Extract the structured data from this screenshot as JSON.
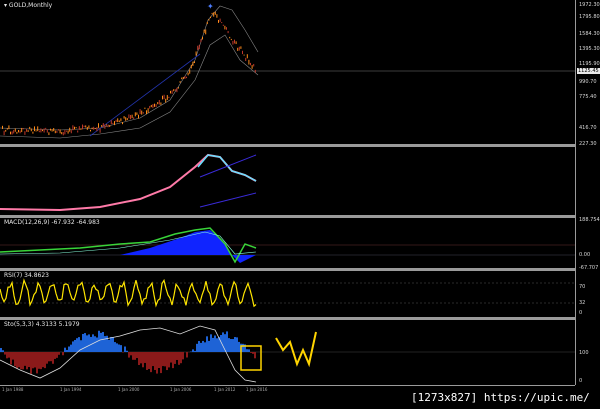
{
  "panes": {
    "main": {
      "label": "GOLD,Monthly",
      "ticks": [
        "1972.30",
        "1795.80",
        "1584.30",
        "1395.30",
        "1195.90",
        "990.70",
        "775.40",
        "416.70",
        "227.30"
      ],
      "price_tag": "1125.45"
    },
    "ma": {
      "label": ""
    },
    "macd": {
      "label": "MACD(12,26,9) -67.932 -64.983",
      "ticks": [
        "188.754",
        "0.00",
        "-67.707"
      ]
    },
    "rsi": {
      "label": "RSI(7) 34.8623",
      "ticks": [
        "70",
        "32",
        "0"
      ]
    },
    "stoch": {
      "label": "Sto(5,3,3) 4.3133 5.1979",
      "ticks": [
        "100",
        "0"
      ]
    }
  },
  "xaxis": {
    "ticks": [
      "1 Jan 1988",
      "1 Jan 1994",
      "1 Jan 2000",
      "1 Jan 2006",
      "1 Jan 2012",
      "1 Jan 2016"
    ]
  },
  "watermark": "[1273x827] https://upic.me/",
  "colors": {
    "bull": "#ff8c1a",
    "bear": "#c0392b",
    "macd_line": "#39d439",
    "macd_hist": "#1024ff",
    "rsi": "#ffe600",
    "stoch_pos": "#1e63d6",
    "stoch_neg": "#8b1a1a",
    "highlight": "#ffd400"
  }
}
